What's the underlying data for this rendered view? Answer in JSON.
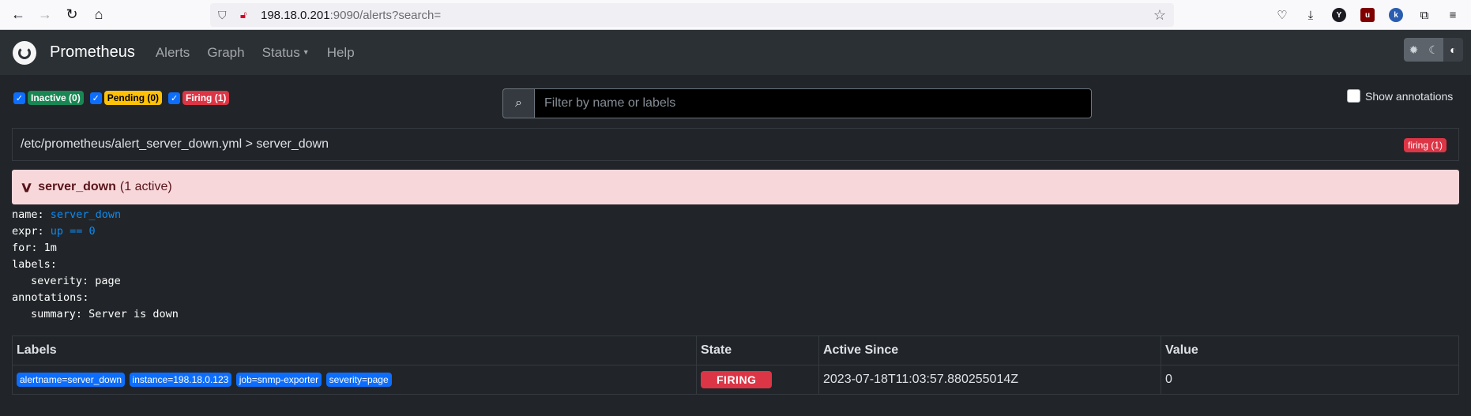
{
  "browser": {
    "url_host": "198.18.0.201",
    "url_rest": ":9090/alerts?search="
  },
  "navbar": {
    "brand": "Prometheus",
    "links": [
      "Alerts",
      "Graph",
      "Status",
      "Help"
    ]
  },
  "filters": {
    "inactive": "Inactive (0)",
    "pending": "Pending (0)",
    "firing": "Firing (1)"
  },
  "search": {
    "placeholder": "Filter by name or labels"
  },
  "show_annotations": "Show annotations",
  "group": {
    "path": "/etc/prometheus/alert_server_down.yml > server_down",
    "badge": "firing (1)"
  },
  "alert": {
    "name": "server_down",
    "count": "(1 active)"
  },
  "rule": {
    "name_key": "name:",
    "name_val": "server_down",
    "expr_key": "expr:",
    "expr_val": "up == 0",
    "for_line": "for: 1m",
    "labels_key": "labels:",
    "severity_line": "severity: page",
    "annotations_key": "annotations:",
    "summary_line": "summary: Server is down"
  },
  "table": {
    "headers": [
      "Labels",
      "State",
      "Active Since",
      "Value"
    ],
    "row": {
      "labels": [
        "alertname=server_down",
        "instance=198.18.0.123",
        "job=snmp-exporter",
        "severity=page"
      ],
      "state": "FIRING",
      "active_since": "2023-07-18T11:03:57.880255014Z",
      "value": "0"
    }
  }
}
